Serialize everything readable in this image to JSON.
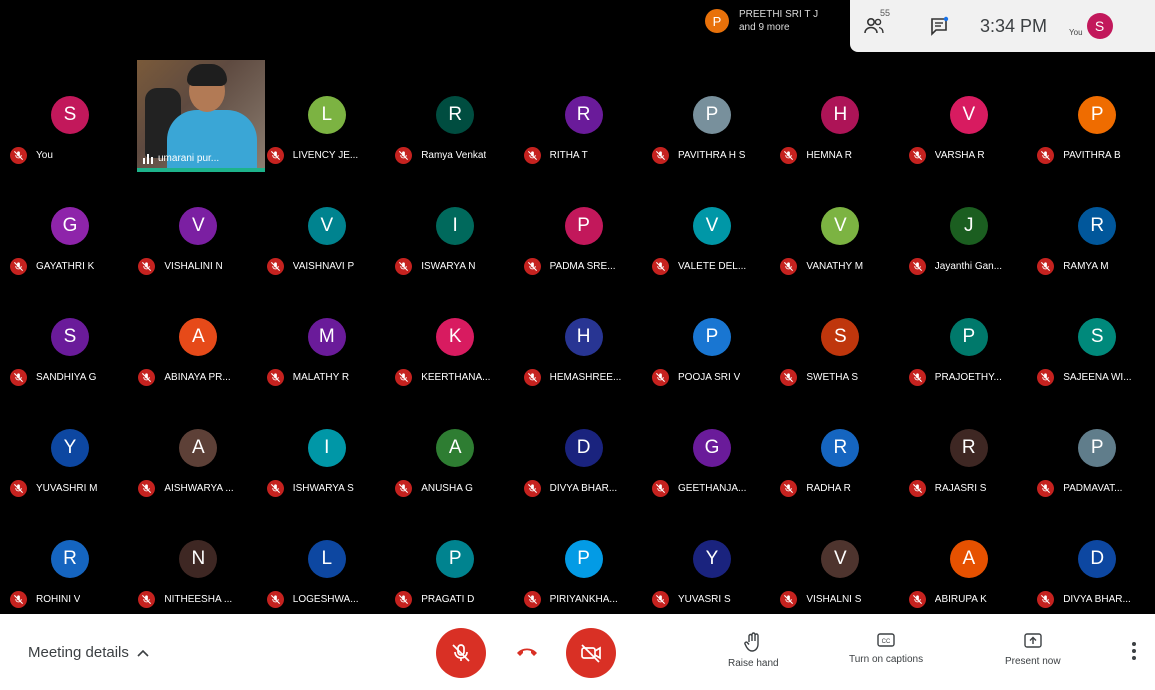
{
  "topbar": {
    "presenter_initial": "P",
    "presenter_line1": "PREETHI SRI T J",
    "presenter_line2": "and 9 more",
    "participants_count": "55",
    "time": "3:34 PM",
    "you_label": "You",
    "you_initial": "S"
  },
  "video_tile": {
    "name": "umarani pur..."
  },
  "tiles": [
    {
      "initial": "S",
      "name": "You",
      "color": "#c2185b"
    },
    {
      "initial": "L",
      "name": "LIVENCY JE...",
      "color": "#7cb342"
    },
    {
      "initial": "R",
      "name": "Ramya Venkat",
      "color": "#004d40"
    },
    {
      "initial": "R",
      "name": "RITHA T",
      "color": "#6a1b9a"
    },
    {
      "initial": "P",
      "name": "PAVITHRA H S",
      "color": "#78909c"
    },
    {
      "initial": "H",
      "name": "HEMNA R",
      "color": "#ad1457"
    },
    {
      "initial": "V",
      "name": "VARSHA R",
      "color": "#d81b60"
    },
    {
      "initial": "P",
      "name": "PAVITHRA B",
      "color": "#ef6c00"
    },
    {
      "initial": "G",
      "name": "GAYATHRI K",
      "color": "#8e24aa"
    },
    {
      "initial": "V",
      "name": "VISHALINI N",
      "color": "#7b1fa2"
    },
    {
      "initial": "V",
      "name": "VAISHNAVI P",
      "color": "#00838f"
    },
    {
      "initial": "I",
      "name": "ISWARYA N",
      "color": "#00695c"
    },
    {
      "initial": "P",
      "name": "PADMA SRE...",
      "color": "#c2185b"
    },
    {
      "initial": "V",
      "name": "VALETE DEL...",
      "color": "#0097a7"
    },
    {
      "initial": "V",
      "name": "VANATHY M",
      "color": "#7cb342"
    },
    {
      "initial": "J",
      "name": "Jayanthi Gan...",
      "color": "#1b5e20"
    },
    {
      "initial": "R",
      "name": "RAMYA M",
      "color": "#01579b"
    },
    {
      "initial": "S",
      "name": "SANDHIYA G",
      "color": "#6a1b9a"
    },
    {
      "initial": "A",
      "name": "ABINAYA PR...",
      "color": "#e64a19"
    },
    {
      "initial": "M",
      "name": "MALATHY R",
      "color": "#6a1b9a"
    },
    {
      "initial": "K",
      "name": "KEERTHANA...",
      "color": "#d81b60"
    },
    {
      "initial": "H",
      "name": "HEMASHREE...",
      "color": "#283593"
    },
    {
      "initial": "P",
      "name": "POOJA SRI V",
      "color": "#1976d2"
    },
    {
      "initial": "S",
      "name": "SWETHA S",
      "color": "#bf360c"
    },
    {
      "initial": "P",
      "name": "PRAJOETHY...",
      "color": "#00796b"
    },
    {
      "initial": "S",
      "name": "SAJEENA WI...",
      "color": "#00897b"
    },
    {
      "initial": "Y",
      "name": "YUVASHRI M",
      "color": "#0d47a1"
    },
    {
      "initial": "A",
      "name": "AISHWARYA ...",
      "color": "#5d4037"
    },
    {
      "initial": "I",
      "name": "ISHWARYA S",
      "color": "#0097a7"
    },
    {
      "initial": "A",
      "name": "ANUSHA G",
      "color": "#2e7d32"
    },
    {
      "initial": "D",
      "name": "DIVYA BHAR...",
      "color": "#1a237e"
    },
    {
      "initial": "G",
      "name": "GEETHANJA...",
      "color": "#6a1b9a"
    },
    {
      "initial": "R",
      "name": "RADHA R",
      "color": "#1565c0"
    },
    {
      "initial": "R",
      "name": "RAJASRI S",
      "color": "#3e2723"
    },
    {
      "initial": "P",
      "name": "PADMAVAT...",
      "color": "#607d8b"
    },
    {
      "initial": "R",
      "name": "ROHINI V",
      "color": "#1565c0"
    },
    {
      "initial": "N",
      "name": "NITHEESHA ...",
      "color": "#3e2723"
    },
    {
      "initial": "L",
      "name": "LOGESHWA...",
      "color": "#0d47a1"
    },
    {
      "initial": "P",
      "name": "PRAGATI D",
      "color": "#00838f"
    },
    {
      "initial": "P",
      "name": "PIRIYANKHA...",
      "color": "#039be5"
    },
    {
      "initial": "Y",
      "name": "YUVASRI S",
      "color": "#1a237e"
    },
    {
      "initial": "V",
      "name": "VISHALNI S",
      "color": "#4e342e"
    },
    {
      "initial": "A",
      "name": "ABIRUPA K",
      "color": "#e65100"
    },
    {
      "initial": "D",
      "name": "DIVYA BHAR...",
      "color": "#0d47a1"
    }
  ],
  "bottombar": {
    "meeting_details": "Meeting details",
    "raise_hand": "Raise hand",
    "captions": "Turn on captions",
    "present": "Present now"
  }
}
